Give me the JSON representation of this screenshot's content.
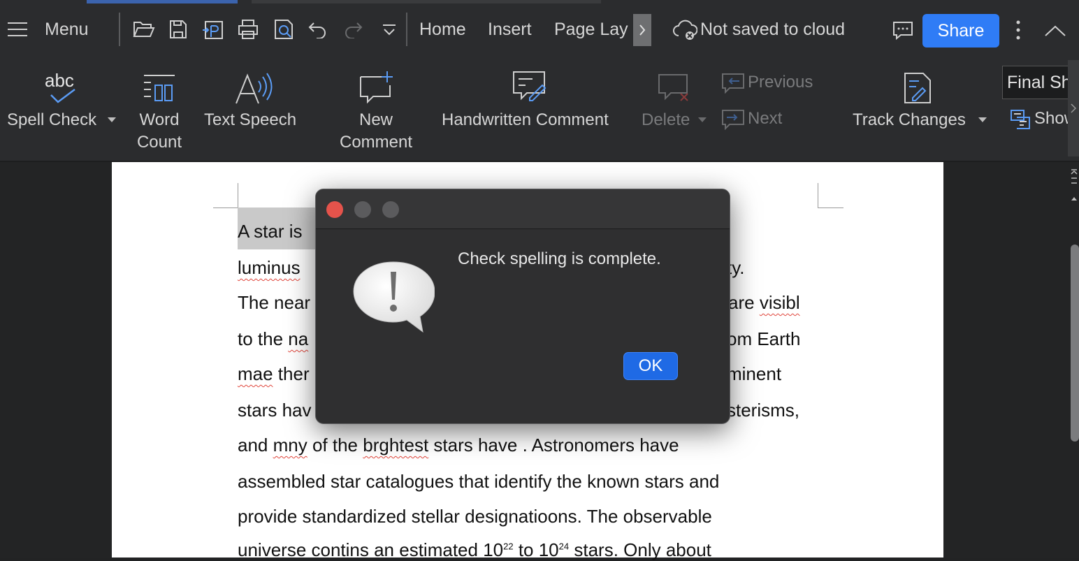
{
  "toolbar": {
    "menu_label": "Menu",
    "tabs": [
      "Home",
      "Insert",
      "Page Lay"
    ],
    "cloud_status": "Not saved to cloud",
    "share_label": "Share"
  },
  "ribbon": {
    "spell_check": "Spell Check",
    "word_count_1": "Word",
    "word_count_2": "Count",
    "text_speech": "Text Speech",
    "new_comment_1": "New",
    "new_comment_2": "Comment",
    "handwritten_comment": "Handwritten Comment",
    "delete": "Delete",
    "previous": "Previous",
    "next": "Next",
    "track_changes": "Track Changes",
    "final_sh": "Final Sh",
    "show": "Show",
    "abc": "abc"
  },
  "document": {
    "line1": "A star is",
    "line2a": "luminus",
    "line2b": "ty.",
    "line3a": "The near",
    "line3b": "are ",
    "line3c": "visibl",
    "line4a": "to the ",
    "line4b": "na",
    "line4c": "om Earth",
    "line5a": "mae",
    "line5b": " ther",
    "line5c": "minent",
    "line6a": "stars hav",
    "line6b": "sterisms,",
    "line7a": "and ",
    "line7b": "mny",
    "line7c": " of the ",
    "line7d": "brghtest",
    "line7e": " stars have . Astronomers have",
    "line8": "assembled star catalogues that identify the known stars and",
    "line9": "provide standardized stellar designatioons. The observable",
    "line10a": "universe contins an estimated 10",
    "line10sup1": "22",
    "line10b": " to 10",
    "line10sup2": "24",
    "line10c": " stars. ",
    "line10d": "Only about"
  },
  "dialog": {
    "message": "Check spelling is complete.",
    "ok_label": "OK"
  }
}
